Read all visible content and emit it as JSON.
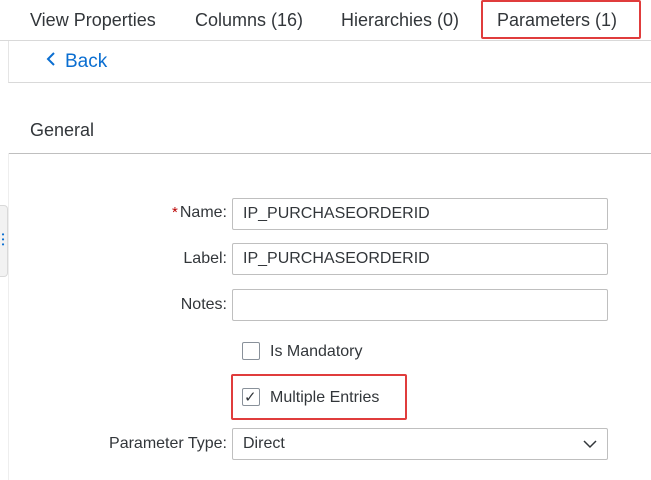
{
  "tabs": [
    {
      "label": "View Properties"
    },
    {
      "label": "Columns (16)"
    },
    {
      "label": "Hierarchies (0)"
    },
    {
      "label": "Parameters (1)",
      "active": true
    }
  ],
  "back": {
    "label": "Back"
  },
  "section": {
    "title": "General"
  },
  "form": {
    "name": {
      "required_mark": "*",
      "label": "Name:",
      "value": "IP_PURCHASEORDERID"
    },
    "label_field": {
      "label": "Label:",
      "value": "IP_PURCHASEORDERID"
    },
    "notes": {
      "label": "Notes:",
      "value": ""
    },
    "is_mandatory": {
      "label": "Is Mandatory",
      "checked": false
    },
    "multiple_entries": {
      "label": "Multiple Entries",
      "checked": true,
      "check_glyph": "✓"
    },
    "parameter_type": {
      "label": "Parameter Type:",
      "value": "Direct"
    }
  },
  "colors": {
    "accent": "#0a6ed1",
    "highlight": "#e03c3c",
    "required": "#bb0000"
  },
  "icons": {
    "back": "chevron-left-icon",
    "dropdown": "chevron-down-icon",
    "handle": "grip-icon"
  }
}
